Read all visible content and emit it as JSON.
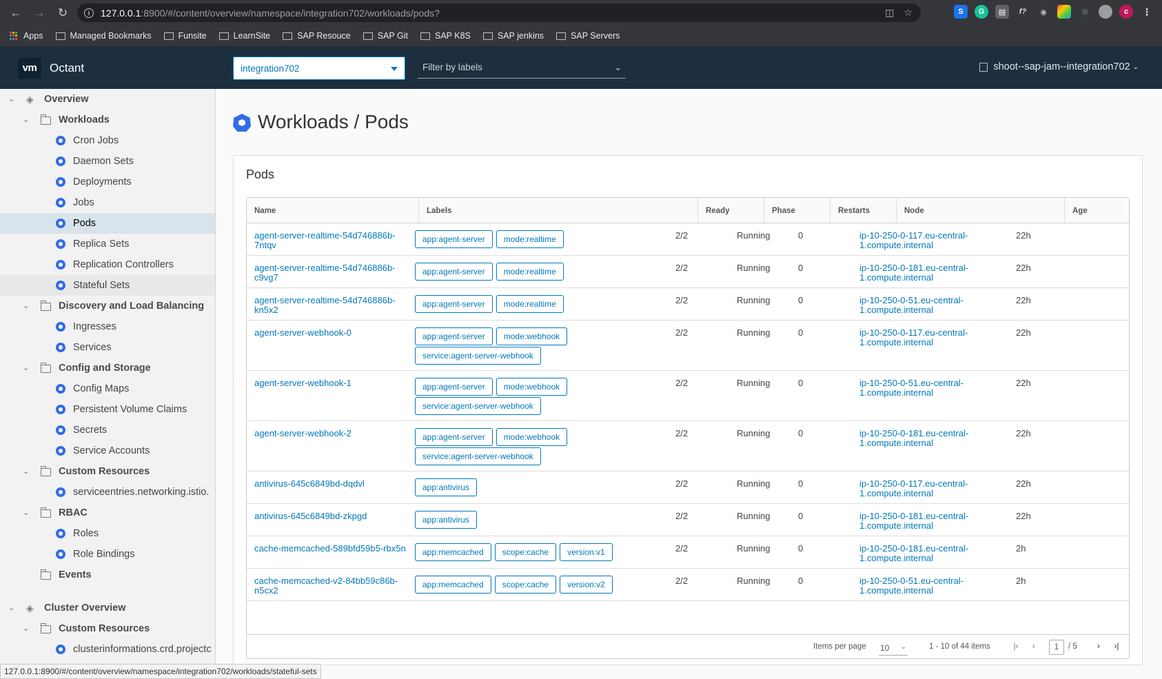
{
  "browser": {
    "url_host": "127.0.0.1",
    "url_rest": ":8900/#/content/overview/namespace/integration702/workloads/pods?",
    "bookmarks": [
      "Apps",
      "Managed Bookmarks",
      "Funsite",
      "LearnSite",
      "SAP Resouce",
      "SAP Git",
      "SAP K8S",
      "SAP jenkins",
      "SAP Servers"
    ],
    "status_url": "127.0.0.1:8900/#/content/overview/namespace/integration702/workloads/stateful-sets",
    "profile_initial": "c"
  },
  "header": {
    "logo": "vm",
    "title": "Octant",
    "namespace": "integration702",
    "label_filter_placeholder": "Filter by labels",
    "context": "shoot--sap-jam--integration702"
  },
  "sidebar": {
    "overview": "Overview",
    "workloads": "Workloads",
    "workload_items": [
      "Cron Jobs",
      "Daemon Sets",
      "Deployments",
      "Jobs",
      "Pods",
      "Replica Sets",
      "Replication Controllers",
      "Stateful Sets"
    ],
    "discovery": "Discovery and Load Balancing",
    "discovery_items": [
      "Ingresses",
      "Services"
    ],
    "config": "Config and Storage",
    "config_items": [
      "Config Maps",
      "Persistent Volume Claims",
      "Secrets",
      "Service Accounts"
    ],
    "custom_resources": "Custom Resources",
    "custom_items": [
      "serviceentries.networking.istio."
    ],
    "rbac": "RBAC",
    "rbac_items": [
      "Roles",
      "Role Bindings"
    ],
    "events": "Events",
    "cluster_overview": "Cluster Overview",
    "cluster_custom_resources": "Custom Resources",
    "cluster_custom_items": [
      "clusterinformations.crd.projectc"
    ]
  },
  "page": {
    "title": "Workloads / Pods",
    "card_title": "Pods"
  },
  "table": {
    "columns": [
      "Name",
      "Labels",
      "Ready",
      "Phase",
      "Restarts",
      "Node",
      "Age"
    ],
    "rows": [
      {
        "name": "agent-server-realtime-54d746886b-7ntqv",
        "labels": [
          "app:agent-server",
          "mode:realtime"
        ],
        "ready": "2/2",
        "phase": "Running",
        "restarts": "0",
        "node": "ip-10-250-0-117.eu-central-1.compute.internal",
        "age": "22h"
      },
      {
        "name": "agent-server-realtime-54d746886b-c9vg7",
        "labels": [
          "app:agent-server",
          "mode:realtime"
        ],
        "ready": "2/2",
        "phase": "Running",
        "restarts": "0",
        "node": "ip-10-250-0-181.eu-central-1.compute.internal",
        "age": "22h"
      },
      {
        "name": "agent-server-realtime-54d746886b-kn5x2",
        "labels": [
          "app:agent-server",
          "mode:realtime"
        ],
        "ready": "2/2",
        "phase": "Running",
        "restarts": "0",
        "node": "ip-10-250-0-51.eu-central-1.compute.internal",
        "age": "22h"
      },
      {
        "name": "agent-server-webhook-0",
        "labels": [
          "app:agent-server",
          "mode:webhook",
          "service:agent-server-webhook"
        ],
        "ready": "2/2",
        "phase": "Running",
        "restarts": "0",
        "node": "ip-10-250-0-117.eu-central-1.compute.internal",
        "age": "22h"
      },
      {
        "name": "agent-server-webhook-1",
        "labels": [
          "app:agent-server",
          "mode:webhook",
          "service:agent-server-webhook"
        ],
        "ready": "2/2",
        "phase": "Running",
        "restarts": "0",
        "node": "ip-10-250-0-51.eu-central-1.compute.internal",
        "age": "22h"
      },
      {
        "name": "agent-server-webhook-2",
        "labels": [
          "app:agent-server",
          "mode:webhook",
          "service:agent-server-webhook"
        ],
        "ready": "2/2",
        "phase": "Running",
        "restarts": "0",
        "node": "ip-10-250-0-181.eu-central-1.compute.internal",
        "age": "22h"
      },
      {
        "name": "antivirus-645c6849bd-dqdvl",
        "labels": [
          "app:antivirus"
        ],
        "ready": "2/2",
        "phase": "Running",
        "restarts": "0",
        "node": "ip-10-250-0-117.eu-central-1.compute.internal",
        "age": "22h"
      },
      {
        "name": "antivirus-645c6849bd-zkpgd",
        "labels": [
          "app:antivirus"
        ],
        "ready": "2/2",
        "phase": "Running",
        "restarts": "0",
        "node": "ip-10-250-0-181.eu-central-1.compute.internal",
        "age": "22h"
      },
      {
        "name": "cache-memcached-589bfd59b5-rbx5n",
        "labels": [
          "app:memcached",
          "scope:cache",
          "version:v1"
        ],
        "ready": "2/2",
        "phase": "Running",
        "restarts": "0",
        "node": "ip-10-250-0-181.eu-central-1.compute.internal",
        "age": "2h"
      },
      {
        "name": "cache-memcached-v2-84bb59c86b-n5cx2",
        "labels": [
          "app:memcached",
          "scope:cache",
          "version:v2"
        ],
        "ready": "2/2",
        "phase": "Running",
        "restarts": "0",
        "node": "ip-10-250-0-51.eu-central-1.compute.internal",
        "age": "2h"
      }
    ],
    "footer": {
      "items_per_page_label": "Items per page",
      "items_per_page": "10",
      "count_text": "1 - 10 of 44 items",
      "current_page": "1",
      "total_pages": "/ 5"
    }
  }
}
